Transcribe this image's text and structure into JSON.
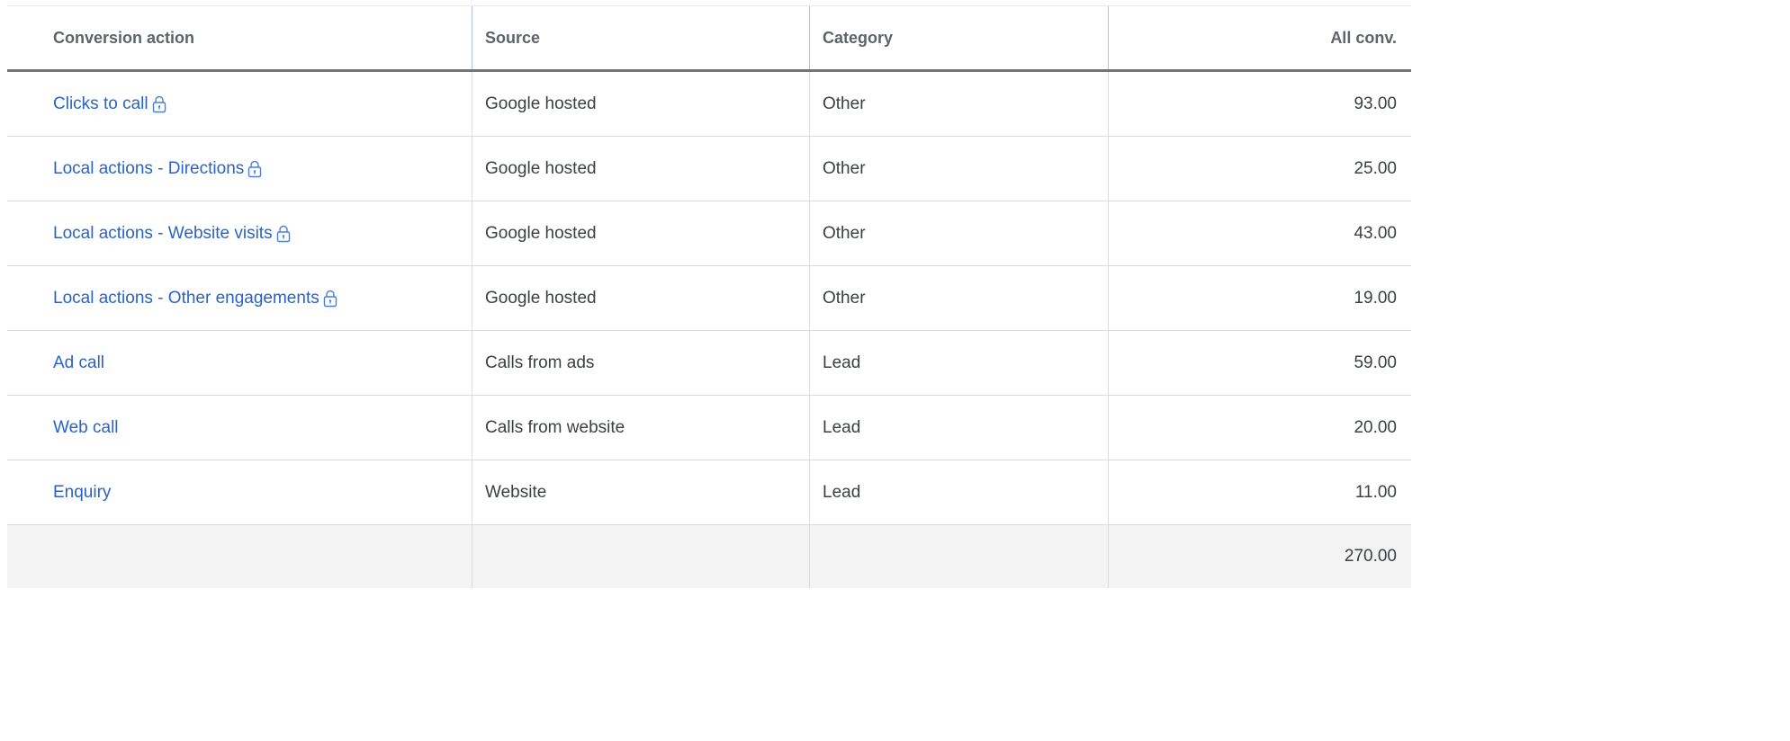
{
  "columns": {
    "conversion_action": "Conversion action",
    "source": "Source",
    "category": "Category",
    "all_conv": "All conv."
  },
  "rows": [
    {
      "action": "Clicks to call",
      "locked": true,
      "source": "Google hosted",
      "category": "Other",
      "all_conv": "93.00"
    },
    {
      "action": "Local actions - Directions",
      "locked": true,
      "source": "Google hosted",
      "category": "Other",
      "all_conv": "25.00"
    },
    {
      "action": "Local actions - Website visits",
      "locked": true,
      "source": "Google hosted",
      "category": "Other",
      "all_conv": "43.00"
    },
    {
      "action": "Local actions - Other engagements",
      "locked": true,
      "source": "Google hosted",
      "category": "Other",
      "all_conv": "19.00"
    },
    {
      "action": "Ad call",
      "locked": false,
      "source": "Calls from ads",
      "category": "Lead",
      "all_conv": "59.00"
    },
    {
      "action": "Web call",
      "locked": false,
      "source": "Calls from website",
      "category": "Lead",
      "all_conv": "20.00"
    },
    {
      "action": "Enquiry",
      "locked": false,
      "source": "Website",
      "category": "Lead",
      "all_conv": "11.00"
    }
  ],
  "total": {
    "all_conv": "270.00"
  },
  "colors": {
    "link": "#2a63c8",
    "lock_icon": "#4a7fd6",
    "total_row_bg": "#f3f3f3"
  },
  "icons": {
    "locked": "lock-icon"
  }
}
